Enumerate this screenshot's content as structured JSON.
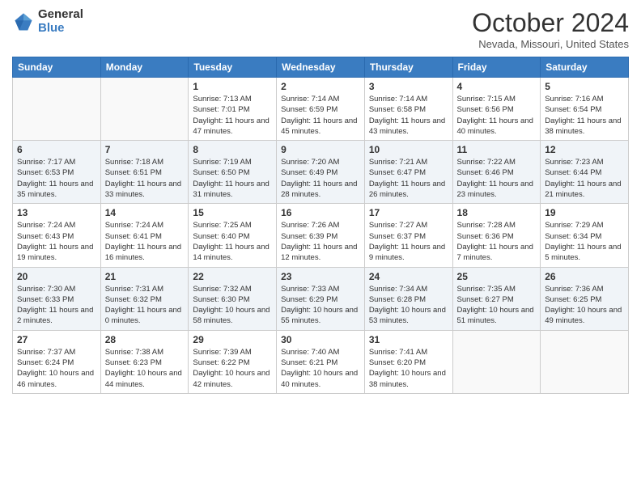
{
  "logo": {
    "general": "General",
    "blue": "Blue"
  },
  "title": "October 2024",
  "subtitle": "Nevada, Missouri, United States",
  "days_of_week": [
    "Sunday",
    "Monday",
    "Tuesday",
    "Wednesday",
    "Thursday",
    "Friday",
    "Saturday"
  ],
  "weeks": [
    [
      {
        "day": "",
        "sunrise": "",
        "sunset": "",
        "daylight": ""
      },
      {
        "day": "",
        "sunrise": "",
        "sunset": "",
        "daylight": ""
      },
      {
        "day": "1",
        "sunrise": "Sunrise: 7:13 AM",
        "sunset": "Sunset: 7:01 PM",
        "daylight": "Daylight: 11 hours and 47 minutes."
      },
      {
        "day": "2",
        "sunrise": "Sunrise: 7:14 AM",
        "sunset": "Sunset: 6:59 PM",
        "daylight": "Daylight: 11 hours and 45 minutes."
      },
      {
        "day": "3",
        "sunrise": "Sunrise: 7:14 AM",
        "sunset": "Sunset: 6:58 PM",
        "daylight": "Daylight: 11 hours and 43 minutes."
      },
      {
        "day": "4",
        "sunrise": "Sunrise: 7:15 AM",
        "sunset": "Sunset: 6:56 PM",
        "daylight": "Daylight: 11 hours and 40 minutes."
      },
      {
        "day": "5",
        "sunrise": "Sunrise: 7:16 AM",
        "sunset": "Sunset: 6:54 PM",
        "daylight": "Daylight: 11 hours and 38 minutes."
      }
    ],
    [
      {
        "day": "6",
        "sunrise": "Sunrise: 7:17 AM",
        "sunset": "Sunset: 6:53 PM",
        "daylight": "Daylight: 11 hours and 35 minutes."
      },
      {
        "day": "7",
        "sunrise": "Sunrise: 7:18 AM",
        "sunset": "Sunset: 6:51 PM",
        "daylight": "Daylight: 11 hours and 33 minutes."
      },
      {
        "day": "8",
        "sunrise": "Sunrise: 7:19 AM",
        "sunset": "Sunset: 6:50 PM",
        "daylight": "Daylight: 11 hours and 31 minutes."
      },
      {
        "day": "9",
        "sunrise": "Sunrise: 7:20 AM",
        "sunset": "Sunset: 6:49 PM",
        "daylight": "Daylight: 11 hours and 28 minutes."
      },
      {
        "day": "10",
        "sunrise": "Sunrise: 7:21 AM",
        "sunset": "Sunset: 6:47 PM",
        "daylight": "Daylight: 11 hours and 26 minutes."
      },
      {
        "day": "11",
        "sunrise": "Sunrise: 7:22 AM",
        "sunset": "Sunset: 6:46 PM",
        "daylight": "Daylight: 11 hours and 23 minutes."
      },
      {
        "day": "12",
        "sunrise": "Sunrise: 7:23 AM",
        "sunset": "Sunset: 6:44 PM",
        "daylight": "Daylight: 11 hours and 21 minutes."
      }
    ],
    [
      {
        "day": "13",
        "sunrise": "Sunrise: 7:24 AM",
        "sunset": "Sunset: 6:43 PM",
        "daylight": "Daylight: 11 hours and 19 minutes."
      },
      {
        "day": "14",
        "sunrise": "Sunrise: 7:24 AM",
        "sunset": "Sunset: 6:41 PM",
        "daylight": "Daylight: 11 hours and 16 minutes."
      },
      {
        "day": "15",
        "sunrise": "Sunrise: 7:25 AM",
        "sunset": "Sunset: 6:40 PM",
        "daylight": "Daylight: 11 hours and 14 minutes."
      },
      {
        "day": "16",
        "sunrise": "Sunrise: 7:26 AM",
        "sunset": "Sunset: 6:39 PM",
        "daylight": "Daylight: 11 hours and 12 minutes."
      },
      {
        "day": "17",
        "sunrise": "Sunrise: 7:27 AM",
        "sunset": "Sunset: 6:37 PM",
        "daylight": "Daylight: 11 hours and 9 minutes."
      },
      {
        "day": "18",
        "sunrise": "Sunrise: 7:28 AM",
        "sunset": "Sunset: 6:36 PM",
        "daylight": "Daylight: 11 hours and 7 minutes."
      },
      {
        "day": "19",
        "sunrise": "Sunrise: 7:29 AM",
        "sunset": "Sunset: 6:34 PM",
        "daylight": "Daylight: 11 hours and 5 minutes."
      }
    ],
    [
      {
        "day": "20",
        "sunrise": "Sunrise: 7:30 AM",
        "sunset": "Sunset: 6:33 PM",
        "daylight": "Daylight: 11 hours and 2 minutes."
      },
      {
        "day": "21",
        "sunrise": "Sunrise: 7:31 AM",
        "sunset": "Sunset: 6:32 PM",
        "daylight": "Daylight: 11 hours and 0 minutes."
      },
      {
        "day": "22",
        "sunrise": "Sunrise: 7:32 AM",
        "sunset": "Sunset: 6:30 PM",
        "daylight": "Daylight: 10 hours and 58 minutes."
      },
      {
        "day": "23",
        "sunrise": "Sunrise: 7:33 AM",
        "sunset": "Sunset: 6:29 PM",
        "daylight": "Daylight: 10 hours and 55 minutes."
      },
      {
        "day": "24",
        "sunrise": "Sunrise: 7:34 AM",
        "sunset": "Sunset: 6:28 PM",
        "daylight": "Daylight: 10 hours and 53 minutes."
      },
      {
        "day": "25",
        "sunrise": "Sunrise: 7:35 AM",
        "sunset": "Sunset: 6:27 PM",
        "daylight": "Daylight: 10 hours and 51 minutes."
      },
      {
        "day": "26",
        "sunrise": "Sunrise: 7:36 AM",
        "sunset": "Sunset: 6:25 PM",
        "daylight": "Daylight: 10 hours and 49 minutes."
      }
    ],
    [
      {
        "day": "27",
        "sunrise": "Sunrise: 7:37 AM",
        "sunset": "Sunset: 6:24 PM",
        "daylight": "Daylight: 10 hours and 46 minutes."
      },
      {
        "day": "28",
        "sunrise": "Sunrise: 7:38 AM",
        "sunset": "Sunset: 6:23 PM",
        "daylight": "Daylight: 10 hours and 44 minutes."
      },
      {
        "day": "29",
        "sunrise": "Sunrise: 7:39 AM",
        "sunset": "Sunset: 6:22 PM",
        "daylight": "Daylight: 10 hours and 42 minutes."
      },
      {
        "day": "30",
        "sunrise": "Sunrise: 7:40 AM",
        "sunset": "Sunset: 6:21 PM",
        "daylight": "Daylight: 10 hours and 40 minutes."
      },
      {
        "day": "31",
        "sunrise": "Sunrise: 7:41 AM",
        "sunset": "Sunset: 6:20 PM",
        "daylight": "Daylight: 10 hours and 38 minutes."
      },
      {
        "day": "",
        "sunrise": "",
        "sunset": "",
        "daylight": ""
      },
      {
        "day": "",
        "sunrise": "",
        "sunset": "",
        "daylight": ""
      }
    ]
  ]
}
